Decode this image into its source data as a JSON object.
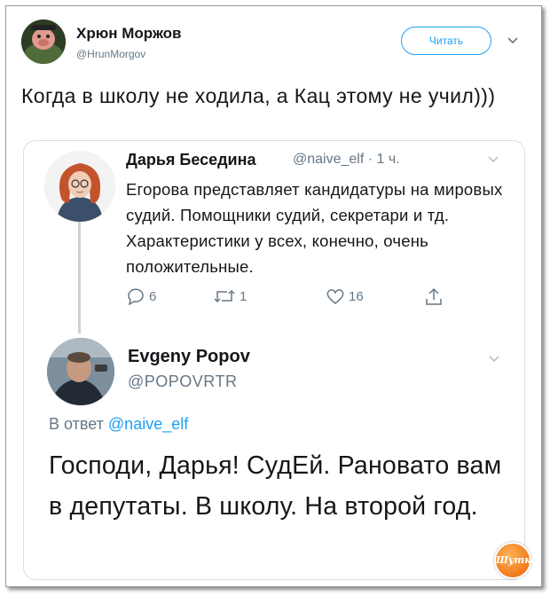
{
  "tweet": {
    "author_name": "Хрюн Моржов",
    "author_handle": "@HrunMorgov",
    "follow_label": "Читать",
    "text": "Когда в школу не ходила, а Кац этому не учил)))"
  },
  "quoted_thread": {
    "original": {
      "author_name": "Дарья Беседина",
      "meta": "@naive_elf · 1 ч.",
      "text": "Егорова представляет кандидатуры на мировых судий. Помощники судий, секретари и тд. Характеристики у всех, конечно, очень положительные.",
      "actions": {
        "reply_count": "6",
        "retweet_count": "1",
        "like_count": "16"
      }
    },
    "reply": {
      "author_name": "Evgeny Popov",
      "author_handle": "@POPOVRTR",
      "reply_prefix": "В ответ",
      "reply_mention": "@naive_elf",
      "text": "Господи, Дарья! СудЕй. Рановато вам в депутаты. В школу. На второй год."
    }
  },
  "watermark": {
    "text": "Шутка"
  },
  "icons": {
    "follow_caret": "chevron-down-icon",
    "reply": "reply-icon",
    "retweet": "retweet-icon",
    "like": "heart-icon",
    "share": "share-icon"
  },
  "colors": {
    "accent": "#1da1f2",
    "muted": "#657786",
    "text": "#14171a",
    "border": "#d8dfe4",
    "watermark": "#f17a1a"
  }
}
